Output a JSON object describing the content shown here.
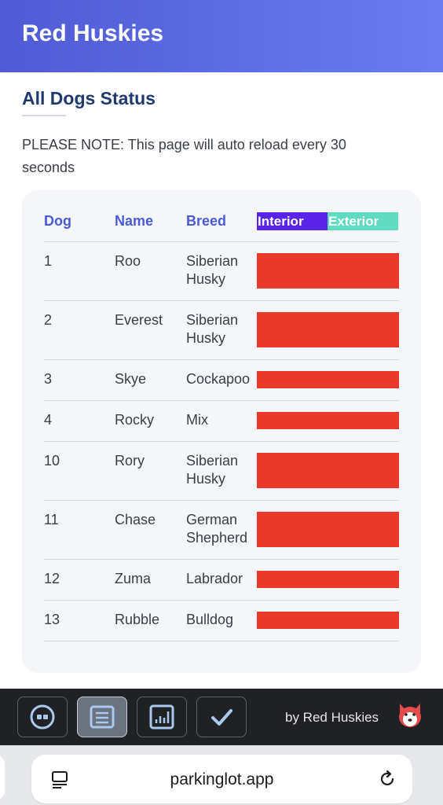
{
  "header": {
    "title": "Red Huskies"
  },
  "section": {
    "title": "All Dogs Status",
    "note": "PLEASE NOTE: This page will auto reload every 30 seconds"
  },
  "table": {
    "headers": {
      "dog": "Dog",
      "name": "Name",
      "breed": "Breed",
      "interior": "Interior",
      "exterior": "Exterior"
    },
    "rows": [
      {
        "dog": "1",
        "name": "Roo",
        "breed": "Siberian Husky"
      },
      {
        "dog": "2",
        "name": "Everest",
        "breed": "Siberian Husky"
      },
      {
        "dog": "3",
        "name": "Skye",
        "breed": "Cockapoo"
      },
      {
        "dog": "4",
        "name": "Rocky",
        "breed": "Mix"
      },
      {
        "dog": "10",
        "name": "Rory",
        "breed": "Siberian Husky"
      },
      {
        "dog": "11",
        "name": "Chase",
        "breed": "German Shepherd"
      },
      {
        "dog": "12",
        "name": "Zuma",
        "breed": "Labrador"
      },
      {
        "dog": "13",
        "name": "Rubble",
        "breed": "Bulldog"
      }
    ],
    "status_color": "#e8392a",
    "interior_color": "#5a24e8",
    "exterior_color": "#5fdbbf"
  },
  "toolbar": {
    "buttons": [
      {
        "icon": "dogs-icon",
        "active": false
      },
      {
        "icon": "list-icon",
        "active": true
      },
      {
        "icon": "chart-icon",
        "active": false
      },
      {
        "icon": "check-icon",
        "active": false
      }
    ],
    "byline": "by Red Huskies",
    "logo_icon": "husky-logo-icon"
  },
  "browser": {
    "url": "parkinglot.app"
  },
  "colors": {
    "header_gradient_start": "#4f5bd5",
    "header_gradient_end": "#6a7cf0",
    "title": "#1e3a6e",
    "table_header": "#4b5ad6"
  }
}
